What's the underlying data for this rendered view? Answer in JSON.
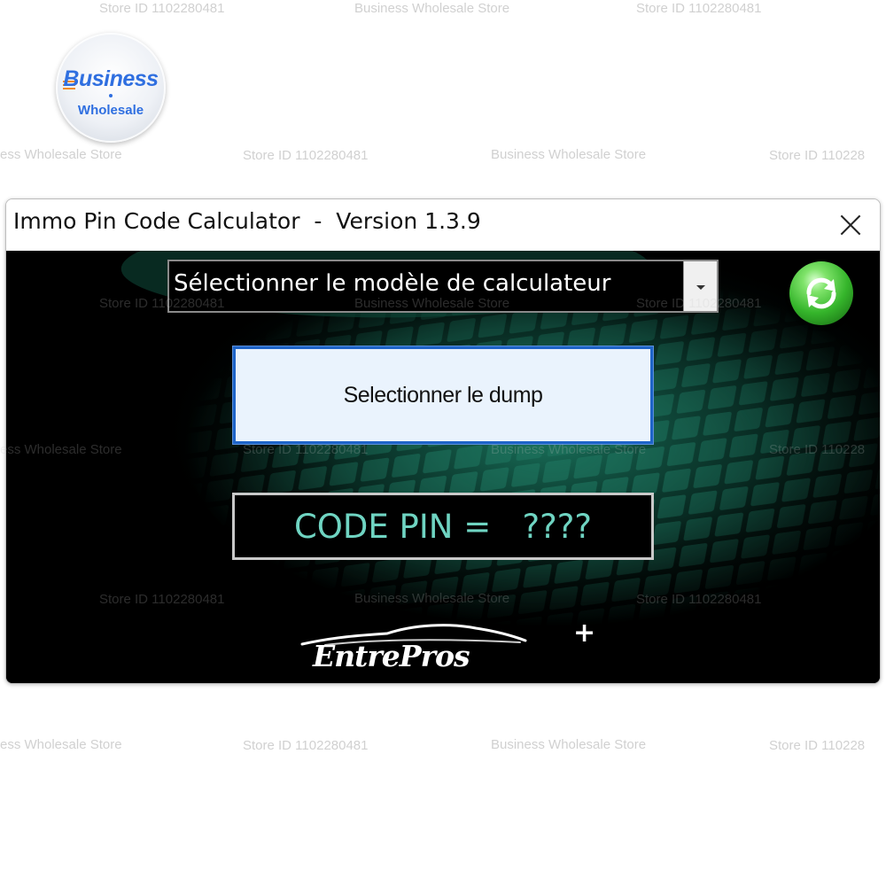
{
  "store_badge": {
    "line1": "Business",
    "line2": "Wholesale"
  },
  "watermarks": {
    "store_id": "Store ID 1102280481",
    "store_name": "Business Wholesale Store",
    "store_name_cut": "ess Wholesale Store",
    "store_id_cut": "Store ID 110228"
  },
  "window": {
    "title": "Immo Pin Code Calculator  -  Version 1.3.9",
    "close_icon": "close-icon"
  },
  "calculator_select": {
    "selected_value": "Sélectionner le modèle de calculateur",
    "arrow_icon": "chevron-down-icon"
  },
  "refresh_button": {
    "icon": "refresh-icon",
    "color": "#35b52b"
  },
  "dump_button": {
    "label": "Selectionner le dump"
  },
  "pin_display": {
    "text": "CODE PIN =   ????",
    "color": "#6fd4c2"
  },
  "brand_logo": {
    "text": "EntrePros",
    "plus": "+"
  },
  "colors": {
    "client_background": "#000000",
    "button_border": "#1e64c8",
    "teal_pattern": "#1c6f5a"
  }
}
